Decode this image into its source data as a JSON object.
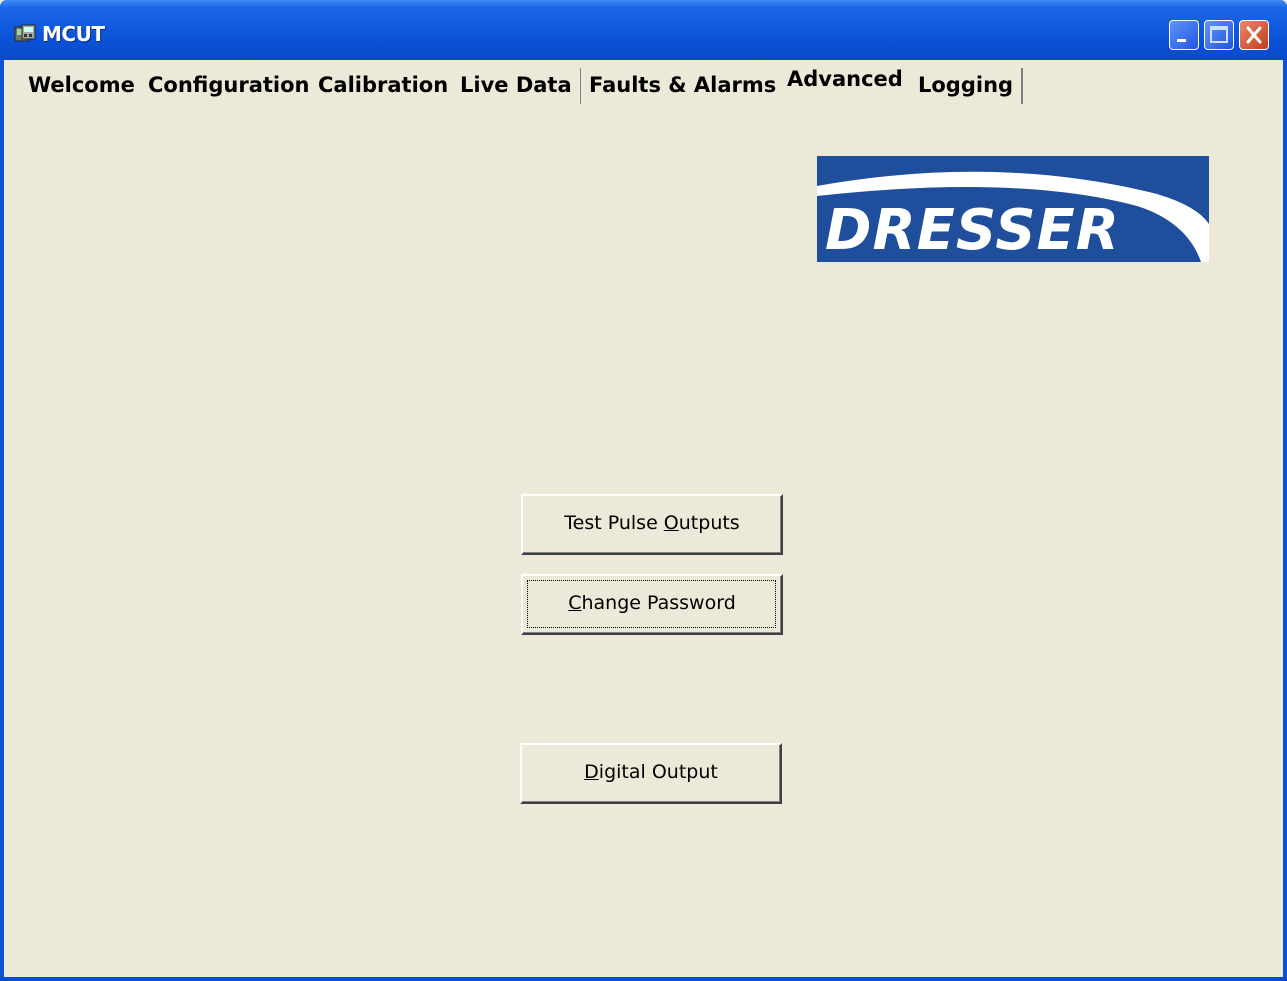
{
  "window": {
    "title": "MCUT",
    "app_icon": "mcut-app-icon",
    "controls": [
      "minimize-icon",
      "maximize-icon",
      "close-icon"
    ]
  },
  "tabs": [
    {
      "label": "Welcome",
      "selected": false
    },
    {
      "label": "Configuration",
      "selected": false
    },
    {
      "label": "Calibration",
      "selected": false
    },
    {
      "label": "Live Data",
      "selected": false
    },
    {
      "label": "Faults & Alarms",
      "selected": false
    },
    {
      "label": "Advanced",
      "selected": true
    },
    {
      "label": "Logging",
      "selected": false
    }
  ],
  "logo": {
    "text": "DRESSER",
    "bg_color": "#1f4e9c",
    "text_color": "#ffffff"
  },
  "buttons": {
    "test_pulse": {
      "pre": "Test Pulse ",
      "accel": "O",
      "post": "utputs"
    },
    "change_password": {
      "pre": "",
      "accel": "C",
      "post": "hange Password",
      "focused": true
    },
    "digital_output": {
      "pre": "",
      "accel": "D",
      "post": "igital Output"
    }
  },
  "colors": {
    "title_bar": "#0a52d8",
    "face": "#ece9d8",
    "close_button": "#c33b1e"
  }
}
